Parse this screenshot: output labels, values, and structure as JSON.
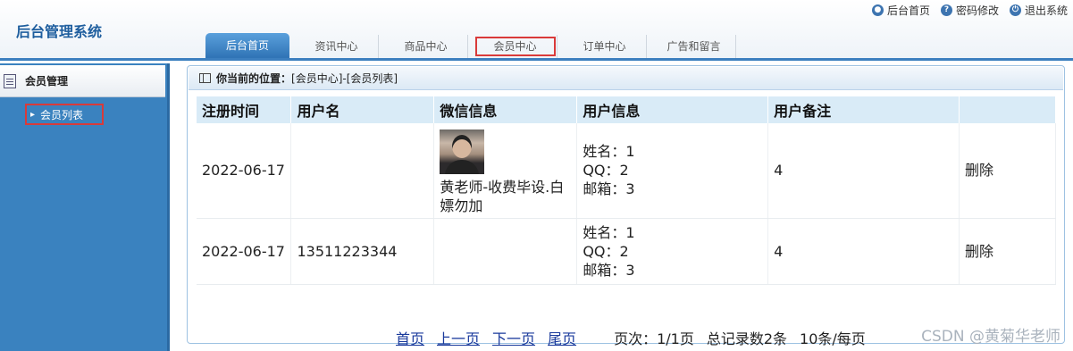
{
  "app": {
    "title": "后台管理系统"
  },
  "top_links": [
    {
      "label": "后台首页",
      "icon": "user-icon"
    },
    {
      "label": "密码修改",
      "icon": "help-icon"
    },
    {
      "label": "退出系统",
      "icon": "power-icon"
    }
  ],
  "nav_tabs": [
    {
      "label": "后台首页",
      "active": true
    },
    {
      "label": "资讯中心"
    },
    {
      "label": "商品中心"
    },
    {
      "label": "会员中心",
      "highlighted": true
    },
    {
      "label": "订单中心"
    },
    {
      "label": "广告和留言"
    }
  ],
  "sidebar": {
    "section_title": "会员管理",
    "items": [
      {
        "label": "会员列表",
        "highlighted": true
      }
    ]
  },
  "breadcrumb": {
    "label": "你当前的位置：",
    "path": "[会员中心]-[会员列表]"
  },
  "table": {
    "headers": [
      "注册时间",
      "用户名",
      "微信信息",
      "用户信息",
      "用户备注",
      ""
    ],
    "rows": [
      {
        "reg_time": "2022-06-17",
        "username": "",
        "wechat_name": "黄老师-收费毕设.白嫖勿加",
        "has_avatar": true,
        "name_line": "姓名：1",
        "qq_line": "QQ：2",
        "email_line": "邮箱：3",
        "remark": "4",
        "action": "删除"
      },
      {
        "reg_time": "2022-06-17",
        "username": "13511223344",
        "wechat_name": "",
        "has_avatar": false,
        "name_line": "姓名：1",
        "qq_line": "QQ：2",
        "email_line": "邮箱：3",
        "remark": "4",
        "action": "删除"
      }
    ]
  },
  "pager": {
    "first": "首页",
    "prev": "上一页",
    "next": "下一页",
    "last": "尾页",
    "page_info": "页次：1/1页",
    "total": "总记录数2条",
    "per_page": "10条/每页"
  },
  "watermark": "CSDN @黄菊华老师",
  "colors": {
    "accent": "#3a82bf",
    "highlight_border": "#d93a3a",
    "header_row": "#d9ebf7"
  }
}
